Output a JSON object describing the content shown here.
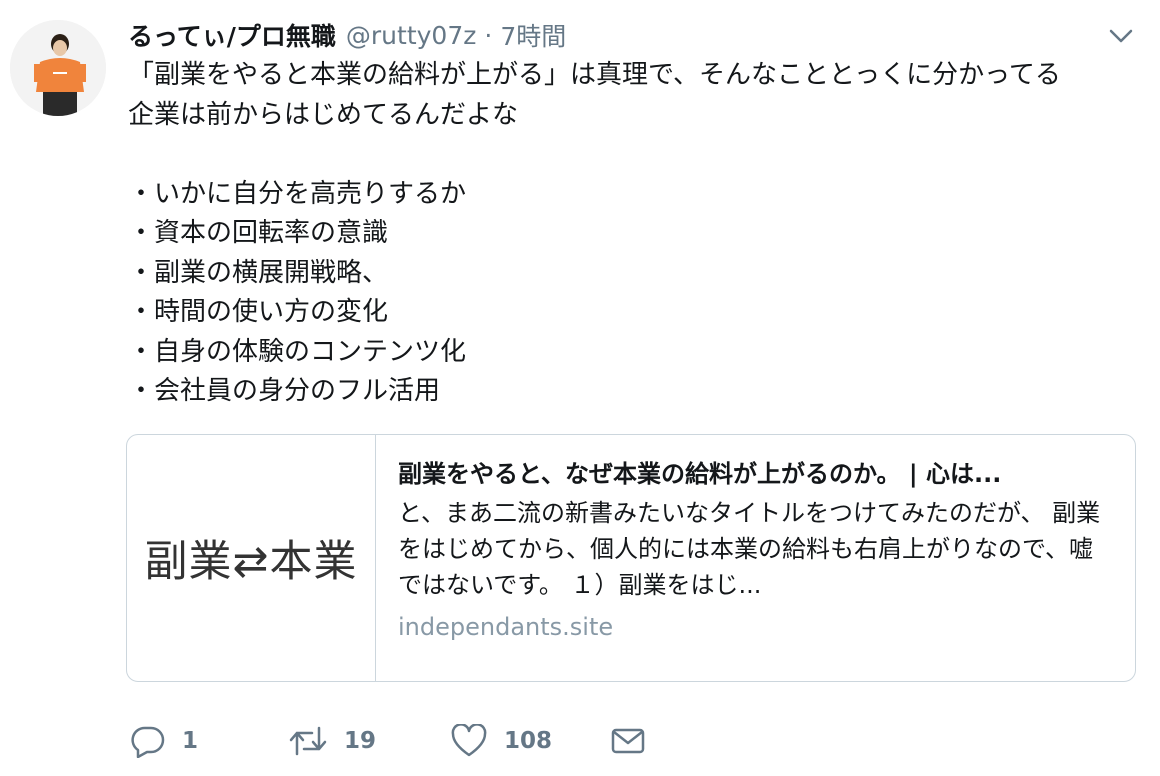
{
  "tweet": {
    "author_name": "るってぃ/プロ無職",
    "author_handle": "@rutty07z",
    "separator": "·",
    "time": "7時間",
    "text": "「副業をやると本業の給料が上がる」は真理で、そんなこととっくに分かってる\n企業は前からはじめてるんだよな\n\n・いかに自分を高売りするか\n・資本の回転率の意識\n・副業の横展開戦略、\n・時間の使い方の変化\n・自身の体験のコンテンツ化\n・会社員の身分のフル活用"
  },
  "card": {
    "thumbnail_text": "副業⇄本業",
    "title": "副業をやると、なぜ本業の給料が上がるのか。 | 心は...",
    "description": "と、まあ二流の新書みたいなタイトルをつけてみたのだが、 副業をはじめてから、個人的には本業の給料も右肩上がりなので、嘘ではないです。 １）副業をはじ...",
    "domain": "independants.site"
  },
  "actions": {
    "reply_count": "1",
    "retweet_count": "19",
    "like_count": "108"
  },
  "icons": {
    "reply": "reply-icon",
    "retweet": "retweet-icon",
    "like": "heart-icon",
    "dm": "envelope-icon",
    "menu": "chevron-down-icon"
  },
  "colors": {
    "secondary_text": "#657786",
    "border": "#ccd6dd",
    "domain_text": "#8899a6",
    "avatar_shirt": "#f0843c"
  }
}
